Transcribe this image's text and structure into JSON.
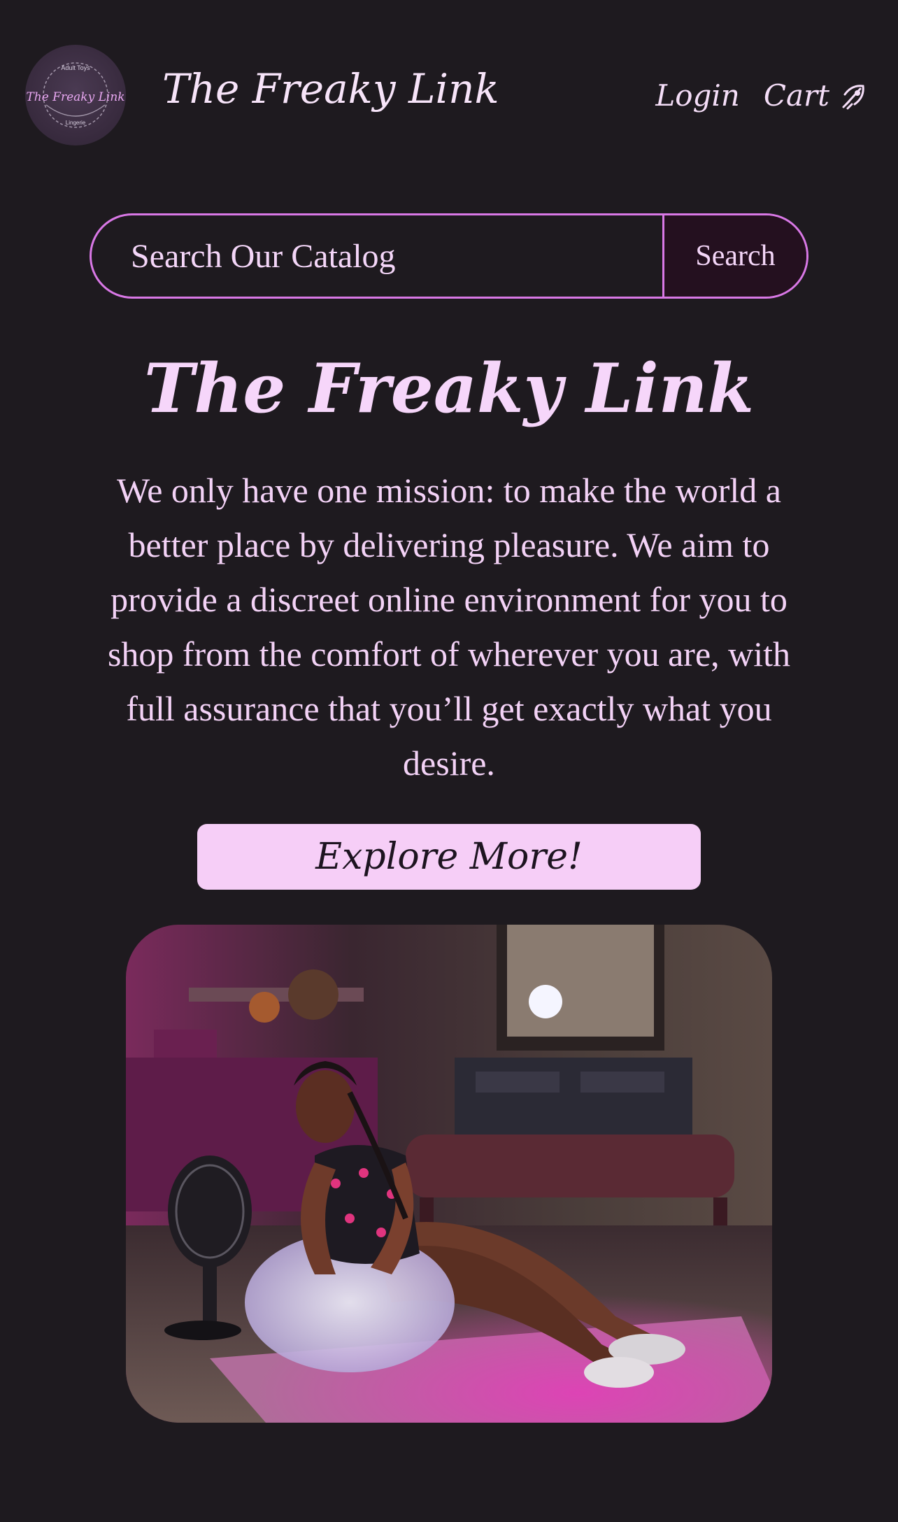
{
  "header": {
    "brand": "The Freaky Link",
    "logo": {
      "top_text": "Adult Toys",
      "script_text": "The Freaky Link",
      "bottom_text": "Lingerie"
    },
    "nav": {
      "login": "Login",
      "cart": "Cart",
      "cart_icon": "cart-rocket-icon"
    }
  },
  "search": {
    "placeholder": "Search Our Catalog",
    "button_label": "Search"
  },
  "hero": {
    "title": "The Freaky Link",
    "mission": "We only have one mission: to make the world a better place by delivering pleasure. We aim to provide a discreet online environment for you to shop from the comfort of wherever you are, with full assurance that you’ll get exactly what you desire.",
    "cta_label": "Explore More!"
  },
  "colors": {
    "background": "#1e1a1f",
    "accent_border": "#d978e6",
    "text_pink": "#f3d2f6",
    "cta_fill": "#f6cef7"
  }
}
